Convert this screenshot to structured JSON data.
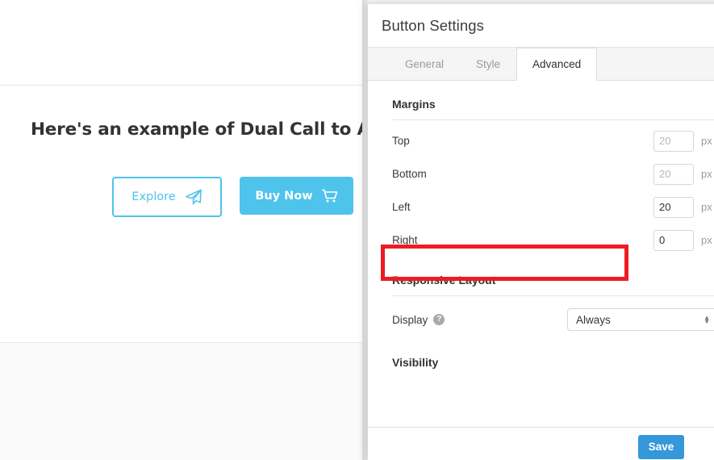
{
  "background_page": {
    "heading": "Here's an example of Dual Call to Action B",
    "buttons": [
      {
        "label": "Explore",
        "icon": "paper-plane-icon",
        "style": "outline",
        "color": "#4EC3EC"
      },
      {
        "label": "Buy Now",
        "icon": "shopping-cart-icon",
        "style": "filled",
        "color": "#4EC3EC"
      }
    ]
  },
  "modal": {
    "title": "Button Settings",
    "tabs": [
      {
        "label": "General",
        "active": false
      },
      {
        "label": "Style",
        "active": false
      },
      {
        "label": "Advanced",
        "active": true
      }
    ],
    "sections": {
      "margins": {
        "title": "Margins",
        "unit": "px",
        "fields": [
          {
            "label": "Top",
            "value": "20",
            "is_placeholder": true
          },
          {
            "label": "Bottom",
            "value": "20",
            "is_placeholder": true
          },
          {
            "label": "Left",
            "value": "20",
            "is_placeholder": false
          },
          {
            "label": "Right",
            "value": "0",
            "is_placeholder": false
          }
        ]
      },
      "responsive_layout": {
        "title": "Responsive Layout",
        "display_label": "Display",
        "display_help_icon": "question-mark-help-icon",
        "display_value": "Always"
      },
      "visibility": {
        "title": "Visibility"
      }
    },
    "footer": {
      "save_label": "Save",
      "save_color": "#3498DB"
    }
  },
  "annotation": {
    "target": "Right margin field row",
    "color": "#ED1C24"
  }
}
